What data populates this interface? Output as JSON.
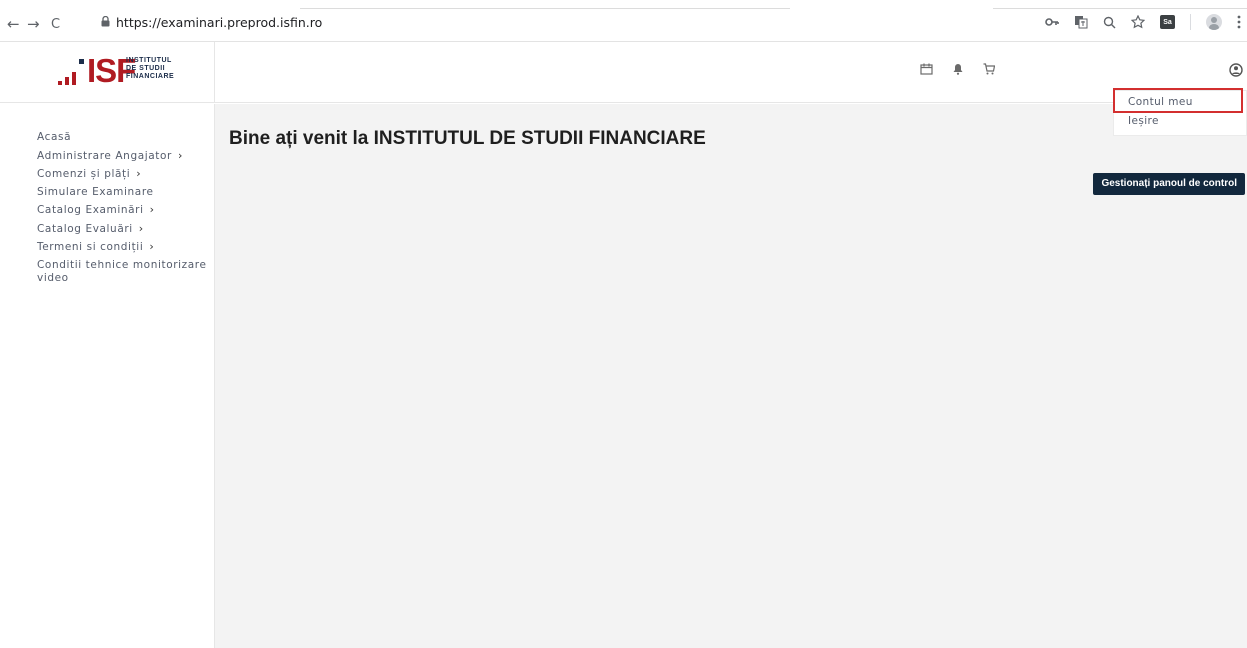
{
  "browser": {
    "back": "←",
    "forward": "→",
    "reload": "C",
    "url": "https://examinari.preprod.isfin.ro",
    "ext_label": "Sa",
    "icons": [
      "key-icon",
      "translate-icon",
      "zoom-icon",
      "star-icon",
      "extension-icon",
      "profile-avatar-icon",
      "menu-kebab-icon"
    ]
  },
  "header": {
    "logo": {
      "text": "ISF",
      "line1": "INSTITUTUL",
      "line2": "DE STUDII",
      "line3": "FINANCIARE"
    },
    "icons": [
      "calendar-icon",
      "bell-icon",
      "cart-icon",
      "user-circle-icon"
    ]
  },
  "sidebar": {
    "items": [
      {
        "label": "Acasă",
        "has_submenu": false
      },
      {
        "label": "Administrare Angajator",
        "has_submenu": true
      },
      {
        "label": "Comenzi și plăți",
        "has_submenu": true
      },
      {
        "label": "Simulare Examinare",
        "has_submenu": false
      },
      {
        "label": "Catalog Examinări",
        "has_submenu": true
      },
      {
        "label": "Catalog Evaluări",
        "has_submenu": true
      },
      {
        "label": "Termeni si condiții",
        "has_submenu": true
      },
      {
        "label": "Conditii tehnice monitorizare video",
        "has_submenu": false
      }
    ],
    "chevron": "›"
  },
  "main": {
    "title": "Bine ați venit la INSTITUTUL DE STUDII FINANCIARE",
    "manage_button": "Gestionați panoul de control"
  },
  "dropdown": {
    "items": [
      "Contul meu",
      "Ieșire"
    ],
    "highlighted": "Contul meu"
  },
  "colors": {
    "brand_red": "#b01b22",
    "brand_navy": "#1c2d4a",
    "button_bg": "#12283d",
    "highlight": "#d32f2f",
    "content_bg": "#f3f3f3"
  }
}
